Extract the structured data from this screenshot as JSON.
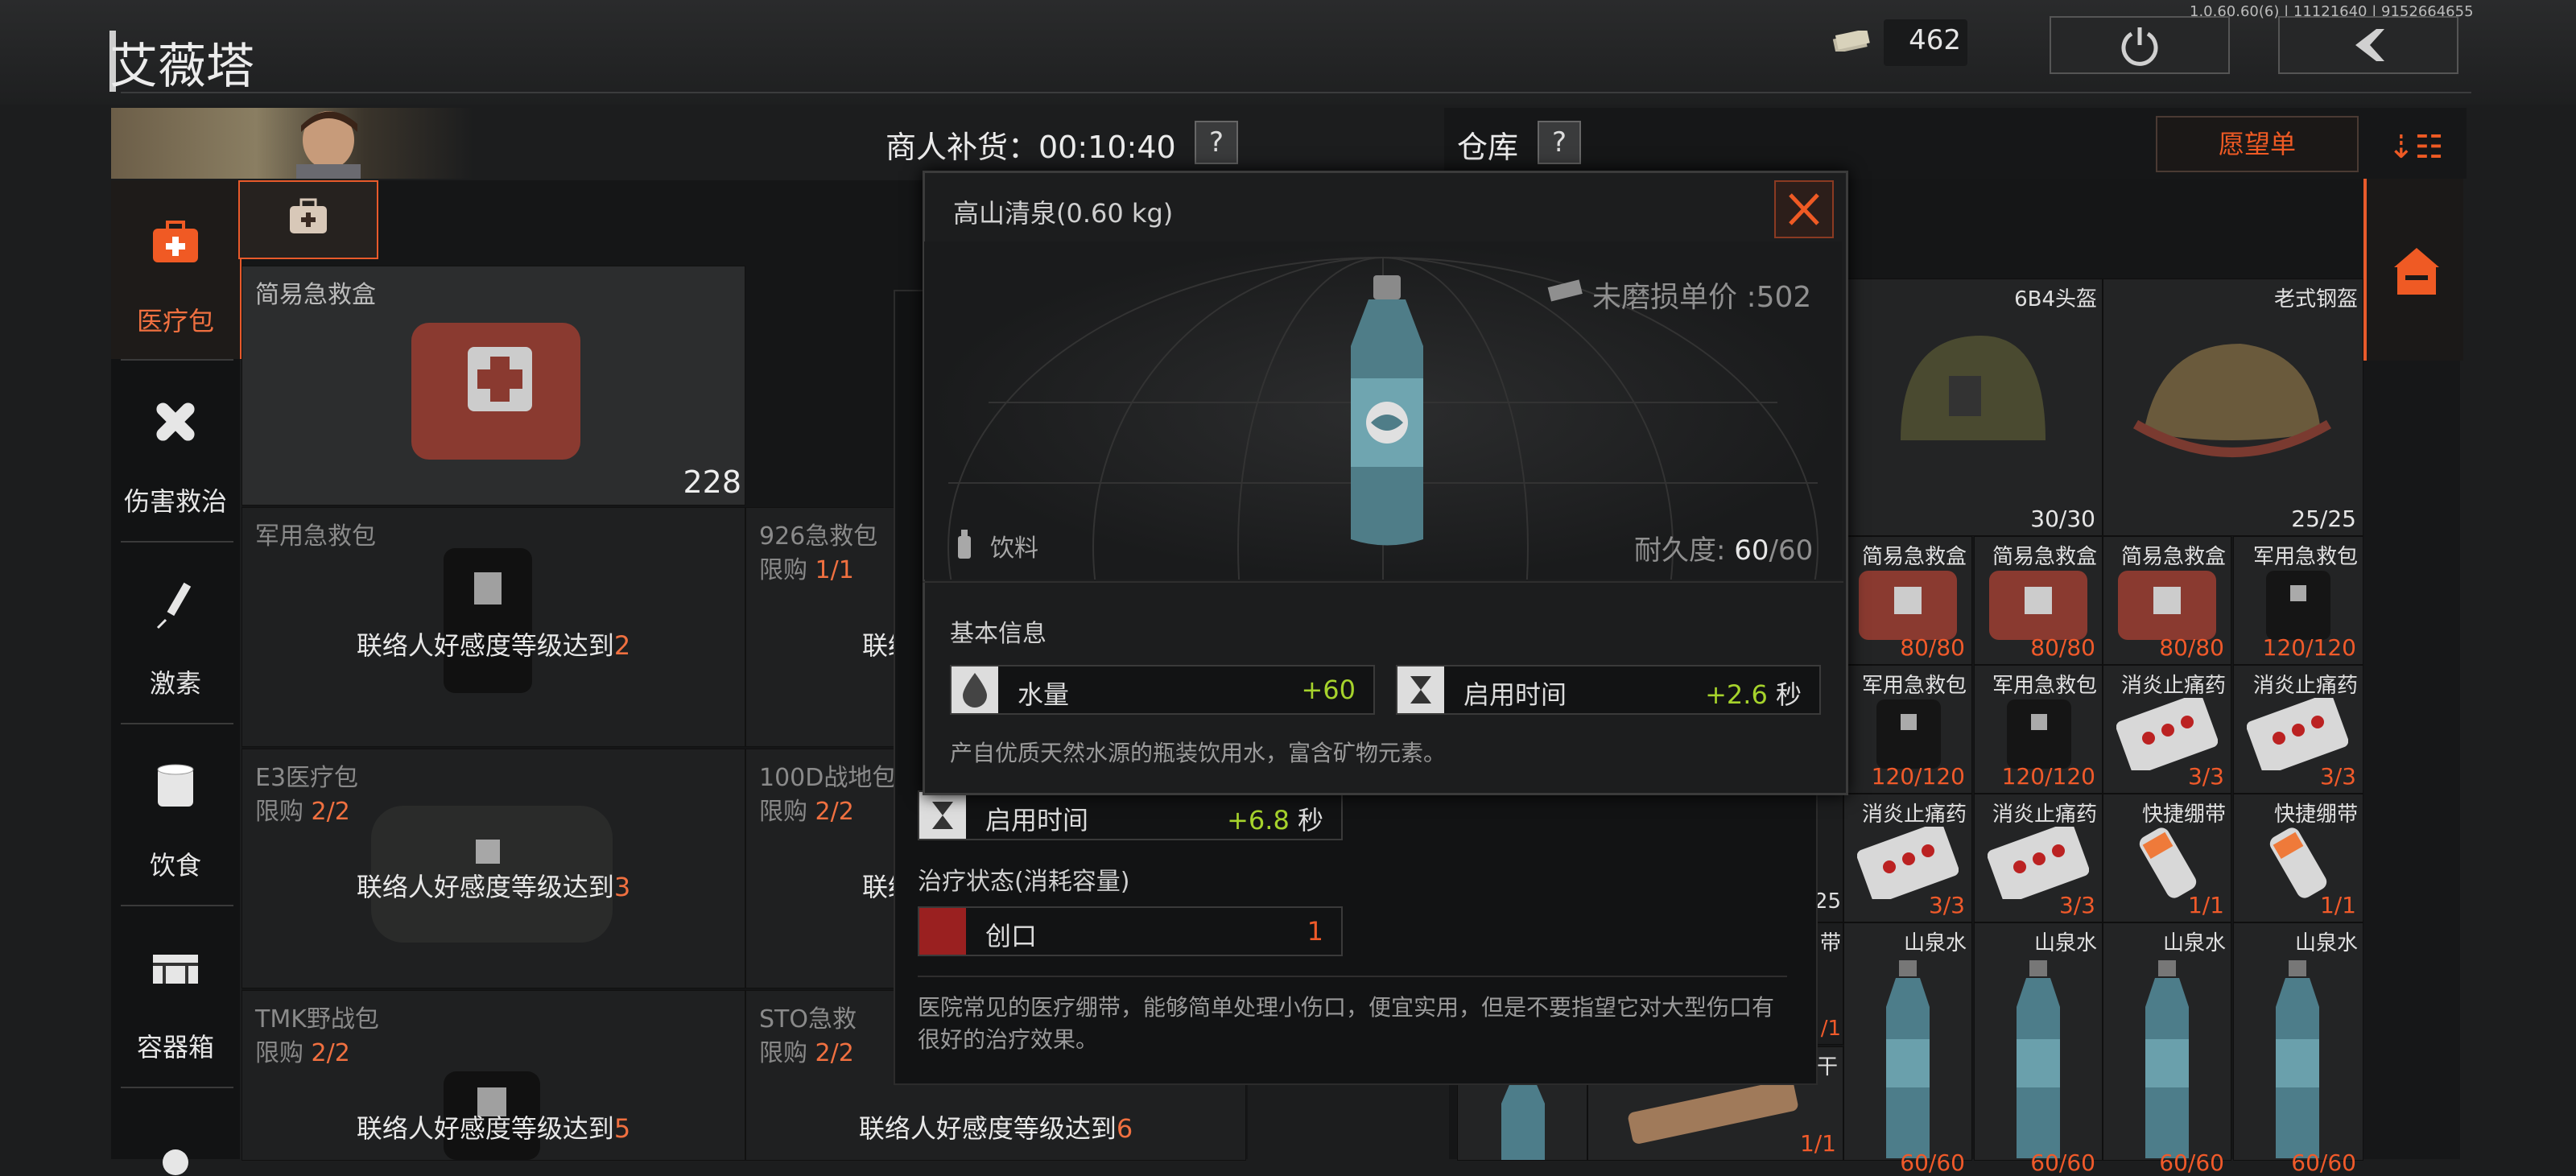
{
  "version": "1.0.60.60(6) | 11121640 | 9152664655",
  "header": {
    "title": "艾薇塔",
    "money": "462"
  },
  "trader": {
    "restock_label": "商人补货：00:10:40",
    "help": "?"
  },
  "warehouse": {
    "label": "仓库",
    "help": "?",
    "wishlist": "愿望单"
  },
  "sidebar": [
    {
      "label": "医疗包",
      "icon": "medkit-icon"
    },
    {
      "label": "伤害救治",
      "icon": "bandage-icon"
    },
    {
      "label": "激素",
      "icon": "syringe-icon"
    },
    {
      "label": "饮食",
      "icon": "food-can-icon"
    },
    {
      "label": "容器箱",
      "icon": "container-icon"
    }
  ],
  "shop_items": [
    {
      "name": "简易急救盒",
      "price": "228"
    },
    {
      "name": "军用急救包",
      "lock_text": "联络人好感度等级达到",
      "lock_level": "2"
    },
    {
      "name": "926急救包",
      "limit": "限购",
      "limit_val": "1/1",
      "lock_text": "联络"
    },
    {
      "name": "E3医疗包",
      "limit": "限购",
      "limit_val": "2/2",
      "lock_text": "联络人好感度等级达到",
      "lock_level": "3"
    },
    {
      "name": "100D战地包",
      "limit": "限购",
      "limit_val": "2/2",
      "lock_text": "联络"
    },
    {
      "name": "TMK野战包",
      "limit": "限购",
      "limit_val": "2/2",
      "lock_text": "联络人好感度等级达到",
      "lock_level": "5"
    },
    {
      "name": "STO急救",
      "limit": "限购",
      "limit_val": "2/2",
      "lock_text": "联络人好感度等级达到",
      "lock_level": "6"
    }
  ],
  "popup": {
    "title": "高山清泉(0.60 kg)",
    "price": "未磨损单价 :502",
    "type": "饮料",
    "durability_label": "耐久度: ",
    "durability_cur": "60",
    "durability_max": "/60",
    "basic_info": "基本信息",
    "water_label": "水量",
    "water_val": "+60",
    "use_time_label": "启用时间",
    "use_time_val": "+2.6",
    "use_time_unit": "秒",
    "description": "产自优质天然水源的瓶装饮用水，富含矿物元素。"
  },
  "popup_lower": {
    "use_time_label": "启用时间",
    "use_time_val": "+6.8",
    "use_time_unit": "秒",
    "treatment_title": "治疗状态(消耗容量)",
    "wound_label": "创口",
    "wound_val": "1",
    "description": "医院常见的医疗绷带，能够简单处理小伤口，便宜实用，但是不要指望它对大型伤口有很好的治疗效果。"
  },
  "inventory": [
    {
      "name": "6B4头盔",
      "count": "30/30"
    },
    {
      "name": "老式钢盔",
      "count": "25/25"
    },
    {
      "name": "简易急救盒",
      "count": "80/80"
    },
    {
      "name": "简易急救盒",
      "count": "80/80"
    },
    {
      "name": "简易急救盒",
      "count": "80/80"
    },
    {
      "name": "军用急救包",
      "count": "120/120"
    },
    {
      "name": "军用急救包",
      "count": "120/120"
    },
    {
      "name": "军用急救包",
      "count": "120/120"
    },
    {
      "name": "消炎止痛药",
      "count": "3/3"
    },
    {
      "name": "消炎止痛药",
      "count": "3/3"
    },
    {
      "name": "消炎止痛药",
      "count": "3/3"
    },
    {
      "name": "消炎止痛药",
      "count": "3/3"
    },
    {
      "name": "快捷绷带",
      "count": "1/1"
    },
    {
      "name": "快捷绷带",
      "count": "1/1"
    },
    {
      "name": "山泉水",
      "count": "60/60"
    },
    {
      "name": "山泉水",
      "count": "60/60"
    },
    {
      "name": "山泉水",
      "count": "60/60"
    },
    {
      "name": "山泉水",
      "count": "60/60"
    }
  ],
  "inventory_partial": {
    "a": "25",
    "b": "带",
    "c": "/1",
    "d": "干",
    "e": "1/1"
  }
}
